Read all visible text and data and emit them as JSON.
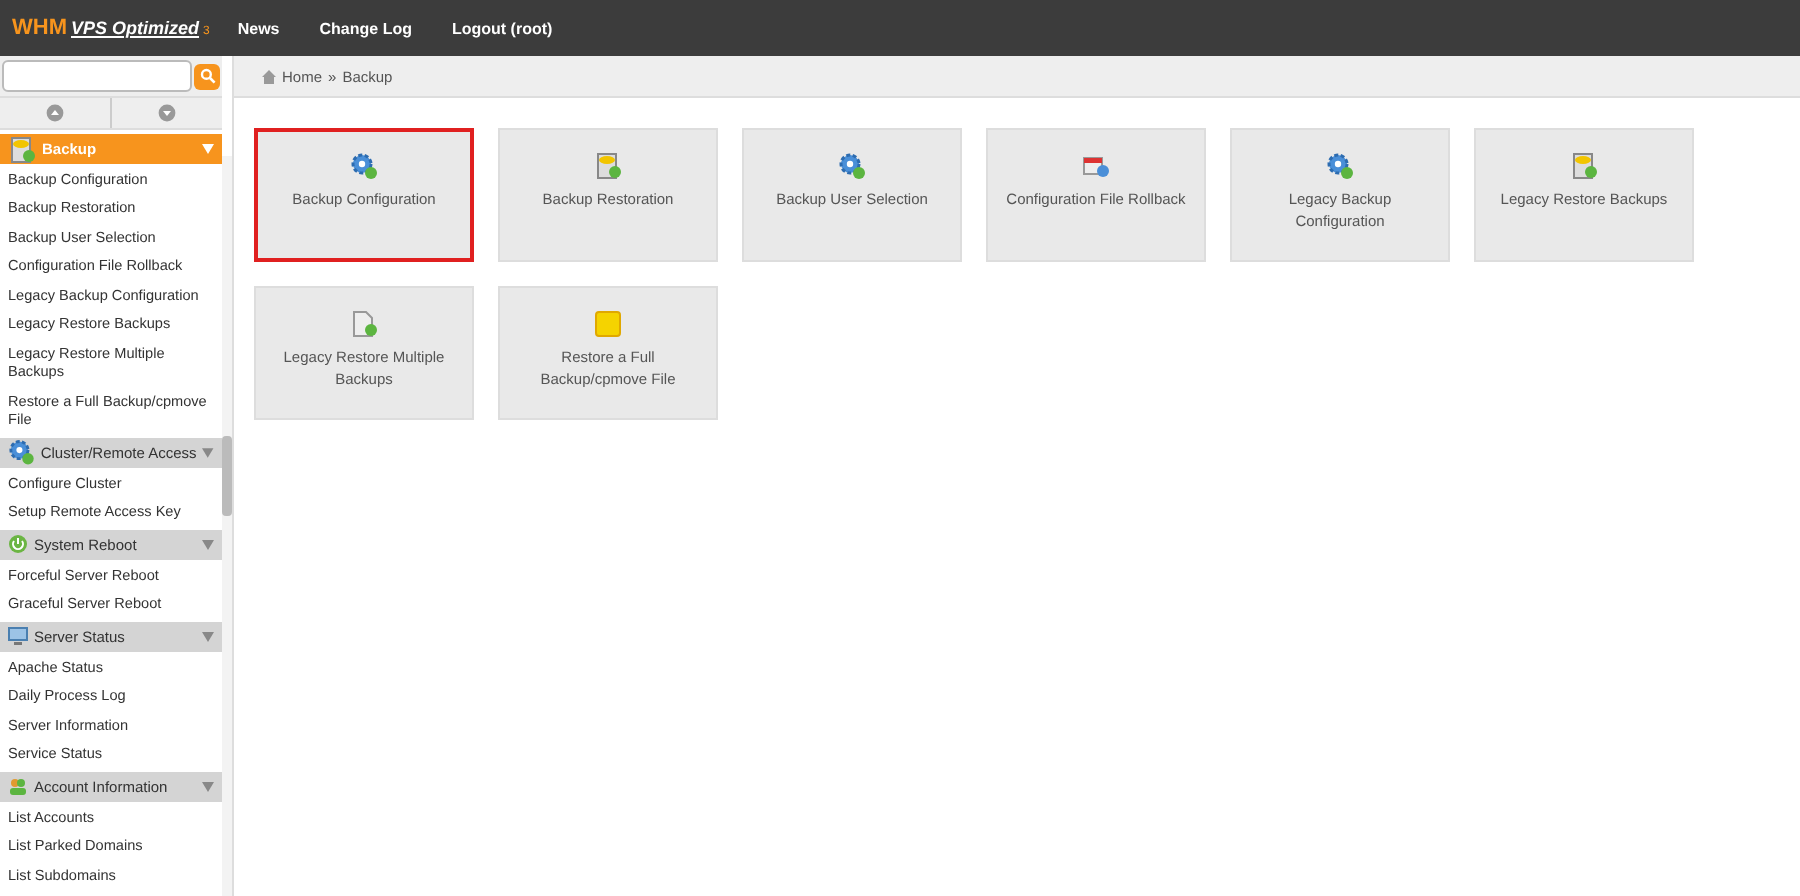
{
  "header": {
    "logo_main": "WHM",
    "logo_sub": "VPS Optimized",
    "logo_version": "3",
    "nav": [
      "News",
      "Change Log",
      "Logout (root)"
    ]
  },
  "breadcrumb": {
    "home": "Home",
    "separator": "»",
    "current": "Backup"
  },
  "sidebar": {
    "sections": [
      {
        "title": "Backup",
        "kind": "db",
        "selected": true,
        "items": [
          "Backup Configuration",
          "Backup Restoration",
          "Backup User Selection",
          "Configuration File Rollback",
          "Legacy Backup Configuration",
          "Legacy Restore Backups",
          "Legacy Restore Multiple Backups",
          "Restore a Full Backup/cpmove File"
        ]
      },
      {
        "title": "Cluster/Remote Access",
        "kind": "gear",
        "selected": false,
        "items": [
          "Configure Cluster",
          "Setup Remote Access Key"
        ]
      },
      {
        "title": "System Reboot",
        "kind": "power",
        "selected": false,
        "items": [
          "Forceful Server Reboot",
          "Graceful Server Reboot"
        ]
      },
      {
        "title": "Server Status",
        "kind": "monitor",
        "selected": false,
        "items": [
          "Apache Status",
          "Daily Process Log",
          "Server Information",
          "Service Status"
        ]
      },
      {
        "title": "Account Information",
        "kind": "users",
        "selected": false,
        "items": [
          "List Accounts",
          "List Parked Domains",
          "List Subdomains"
        ]
      }
    ]
  },
  "cards": [
    {
      "label": "Backup Configuration",
      "kind": "gear",
      "selected": true
    },
    {
      "label": "Backup Restoration",
      "kind": "db",
      "selected": false
    },
    {
      "label": "Backup User Selection",
      "kind": "gear",
      "selected": false
    },
    {
      "label": "Configuration File Rollback",
      "kind": "calendar",
      "selected": false
    },
    {
      "label": "Legacy Backup Configuration",
      "kind": "gear",
      "selected": false
    },
    {
      "label": "Legacy Restore Backups",
      "kind": "db",
      "selected": false
    },
    {
      "label": "Legacy Restore Multiple Backups",
      "kind": "doc",
      "selected": false
    },
    {
      "label": "Restore a Full Backup/cpmove File",
      "kind": "folder",
      "selected": false
    }
  ]
}
